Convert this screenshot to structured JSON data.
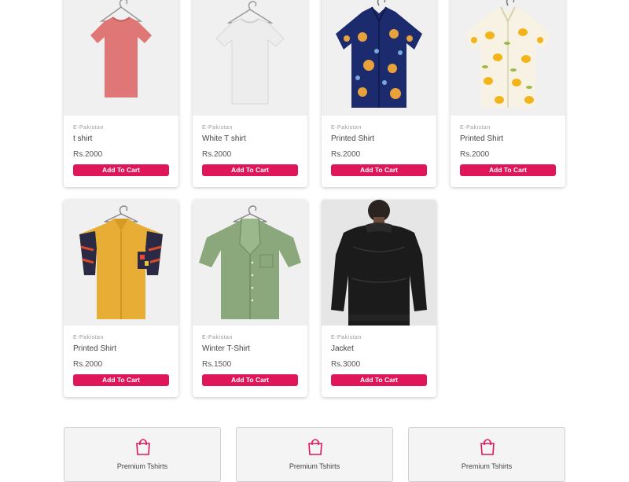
{
  "products": [
    {
      "brand": "E-Pakistan",
      "name": "t shirt",
      "price": "Rs.2000",
      "button": "Add To Cart",
      "image": "pink-tshirt-on-hanger"
    },
    {
      "brand": "E-Pakistan",
      "name": "White T shirt",
      "price": "Rs.2000",
      "button": "Add To Cart",
      "image": "white-tshirt-on-hanger"
    },
    {
      "brand": "E-Pakistan",
      "name": "Printed Shirt",
      "price": "Rs.2000",
      "button": "Add To Cart",
      "image": "navy-sun-moon-print-shirt"
    },
    {
      "brand": "E-Pakistan",
      "name": "Printed Shirt",
      "price": "Rs.2000",
      "button": "Add To Cart",
      "image": "lemon-print-shirt"
    },
    {
      "brand": "E-Pakistan",
      "name": "Printed Shirt",
      "price": "Rs.2000",
      "button": "Add To Cart",
      "image": "yellow-patch-shirt"
    },
    {
      "brand": "E-Pakistan",
      "name": "Winter T-Shirt",
      "price": "Rs.1500",
      "button": "Add To Cart",
      "image": "green-shirt-on-hanger"
    },
    {
      "brand": "E-Pakistan",
      "name": "Jacket",
      "price": "Rs.3000",
      "button": "Add To Cart",
      "image": "black-leather-jacket"
    }
  ],
  "categories": [
    {
      "label": "Premium Tshirts",
      "icon": "shopping-bag-icon"
    },
    {
      "label": "Premium Tshirts",
      "icon": "shopping-bag-icon"
    },
    {
      "label": "Premium Tshirts",
      "icon": "shopping-bag-icon"
    }
  ],
  "colors": {
    "accent": "#e0165a"
  }
}
